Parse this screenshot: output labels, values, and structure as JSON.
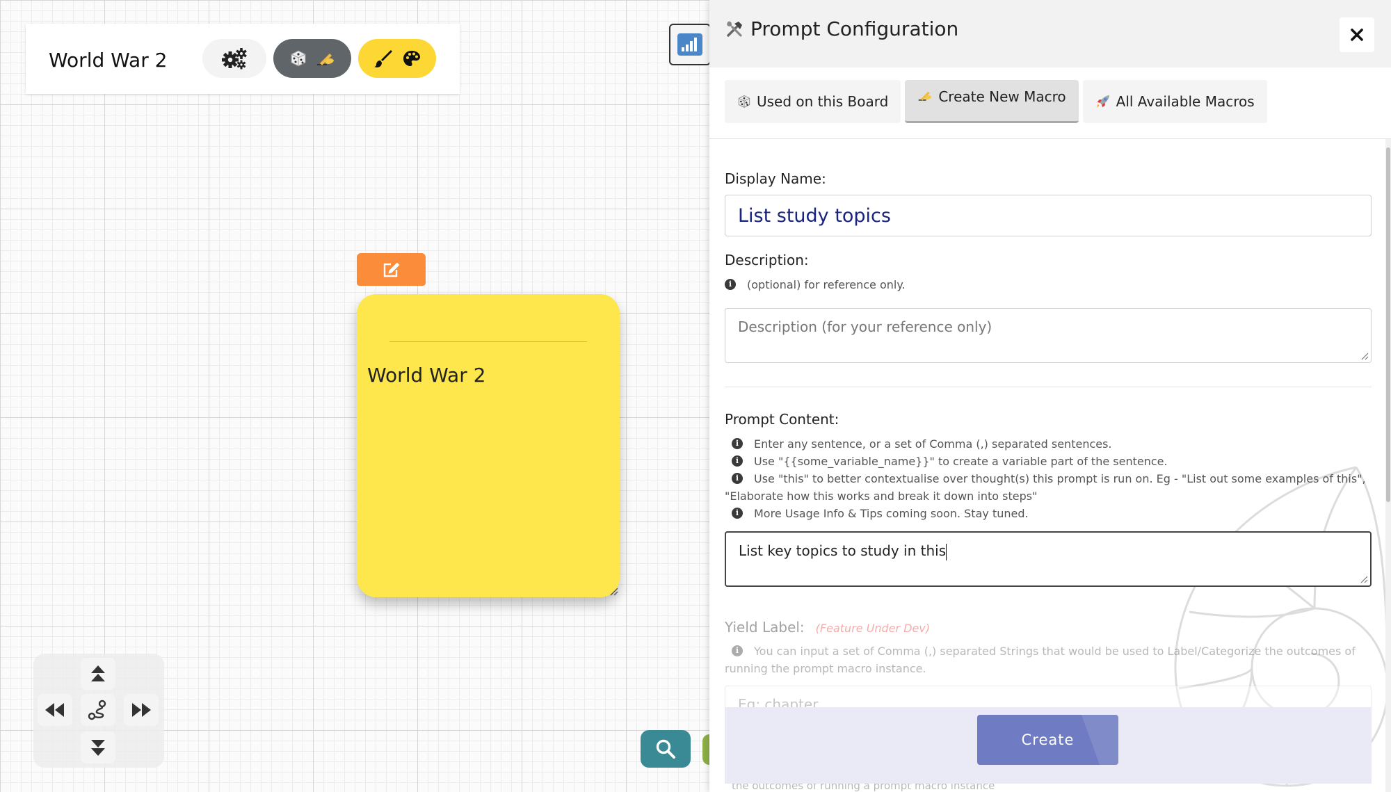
{
  "board": {
    "title": "World War 2"
  },
  "note": {
    "title": "World War 2"
  },
  "panel": {
    "title": "Prompt Configuration",
    "tabs": [
      {
        "label": "Used on this Board",
        "icon": "dice-icon"
      },
      {
        "label": "Create New Macro",
        "icon": "writing-hand-icon",
        "active": true
      },
      {
        "label": "All Available Macros",
        "icon": "rocket-icon"
      }
    ],
    "display_name_label": "Display Name:",
    "display_name_value": "List study topics",
    "description_label": "Description:",
    "description_hint": "(optional) for reference only.",
    "description_placeholder": "Description (for your reference only)",
    "prompt_label": "Prompt Content:",
    "prompt_hints": [
      "Enter any sentence, or a set of Comma (,) separated sentences.",
      "Use \"{{some_variable_name}}\" to create a variable part of the sentence.",
      "Use \"this\" to better contextualise over thought(s) this prompt is run on. Eg - \"List out some examples of this\", \"Elaborate how this works and break it down into steps\"",
      "More Usage Info & Tips coming soon. Stay tuned."
    ],
    "prompt_value": "List key topics to study in this",
    "yield_label": "Yield Label:",
    "yield_badge": "(Feature Under Dev)",
    "yield_hint": "You can input a set of Comma (,) separated Strings that would be used to Label/Categorize the outcomes of running the prompt macro instance.",
    "yield_placeholder": "Eg: chapter",
    "hidden_hint_tail": "the outcomes of running a prompt macro instance",
    "create_label": "Create"
  },
  "colors": {
    "note": "#fde74c",
    "edit_tab": "#fb8c3a",
    "theme_button": "#fdd835",
    "search_fab": "#3a8a96",
    "create_button": "#6f7bc3",
    "badge": "#e53935"
  }
}
